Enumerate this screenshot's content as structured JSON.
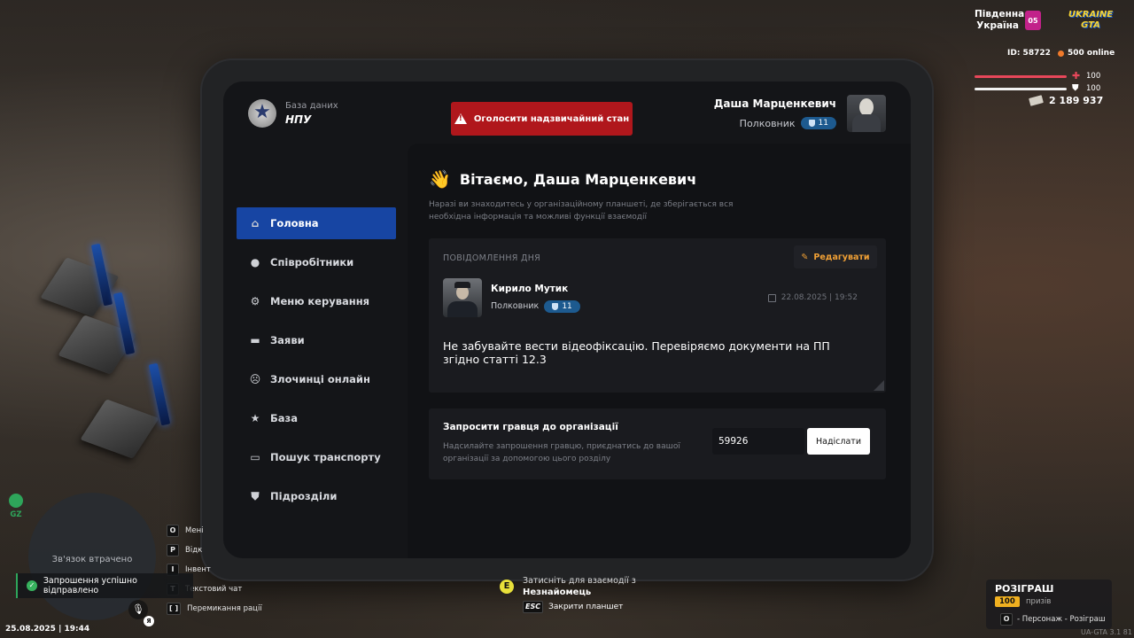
{
  "tablet": {
    "logo_sub": "База даних",
    "logo_title": "НПУ",
    "emergency_label": "Оголосити надзвичайний стан",
    "profile": {
      "name": "Даша Марценкевич",
      "rank": "Полковник",
      "badge": "11"
    },
    "nav": [
      {
        "label": "Головна",
        "icon": "home-icon"
      },
      {
        "label": "Співробітники",
        "icon": "users-icon"
      },
      {
        "label": "Меню керування",
        "icon": "gear-icon"
      },
      {
        "label": "Заяви",
        "icon": "folder-icon"
      },
      {
        "label": "Злочинці онлайн",
        "icon": "criminal-icon"
      },
      {
        "label": "База",
        "icon": "star-icon"
      },
      {
        "label": "Пошук транспорту",
        "icon": "car-icon"
      },
      {
        "label": "Підрозділи",
        "icon": "shield-icon"
      }
    ],
    "welcome": "Вітаємо, Даша Марценкевич",
    "intro": "Наразі ви знаходитесь у організаційному планшеті, де зберігається вся необхідна інформація та можливі функції взаємодії",
    "motd": {
      "label": "ПОВІДОМЛЕННЯ ДНЯ",
      "edit_label": "Редагувати",
      "author": "Кирило Мутик",
      "author_rank": "Полковник",
      "author_badge": "11",
      "date": "22.08.2025 | 19:52",
      "text": "Не забувайте вести відеофіксацію. Перевіряємо документи на ПП згідно статті 12.3"
    },
    "invite": {
      "title": "Запросити гравця до організації",
      "desc": "Надсилайте запрошення гравцю, приєднатись до вашої організації за допомогою цього розділу",
      "value": "59926",
      "send_label": "Надіслати"
    }
  },
  "hud": {
    "region_line1": "Південна",
    "region_line2": "Україна",
    "server_num": "05",
    "brand_line1": "UKRAINE",
    "brand_line2": "GTA",
    "player_id": "ID: 58722",
    "online": "500 online",
    "health": "100",
    "armor": "100",
    "money": "2 189 937",
    "gz": "GZ",
    "minimap_text": "Зв'язок втрачено",
    "toast": "Запрошення успішно відправлено",
    "datetime": "25.08.2025 | 19:44",
    "mic_key": "Я",
    "keys": [
      {
        "key": "O",
        "label": "Мені"
      },
      {
        "key": "P",
        "label": "Відк"
      },
      {
        "key": "I",
        "label": "Інвент"
      },
      {
        "key": "T",
        "label": "Текстовий чат"
      },
      {
        "key": "[ ]",
        "label": "Перемикання рації"
      }
    ],
    "interact_key": "E",
    "interact_hint": "Затисніть для взаємодії з",
    "interact_target": "Незнайомець",
    "esc_key": "ESC",
    "esc_label": "Закрити планшет",
    "giveaway_title": "РОЗІГРАШ",
    "giveaway_count": "100",
    "giveaway_sub": "призів",
    "giveaway_link_key": "O",
    "giveaway_link": "- Персонаж - Розіграш",
    "version": "UA-GTA 3.1   81"
  }
}
